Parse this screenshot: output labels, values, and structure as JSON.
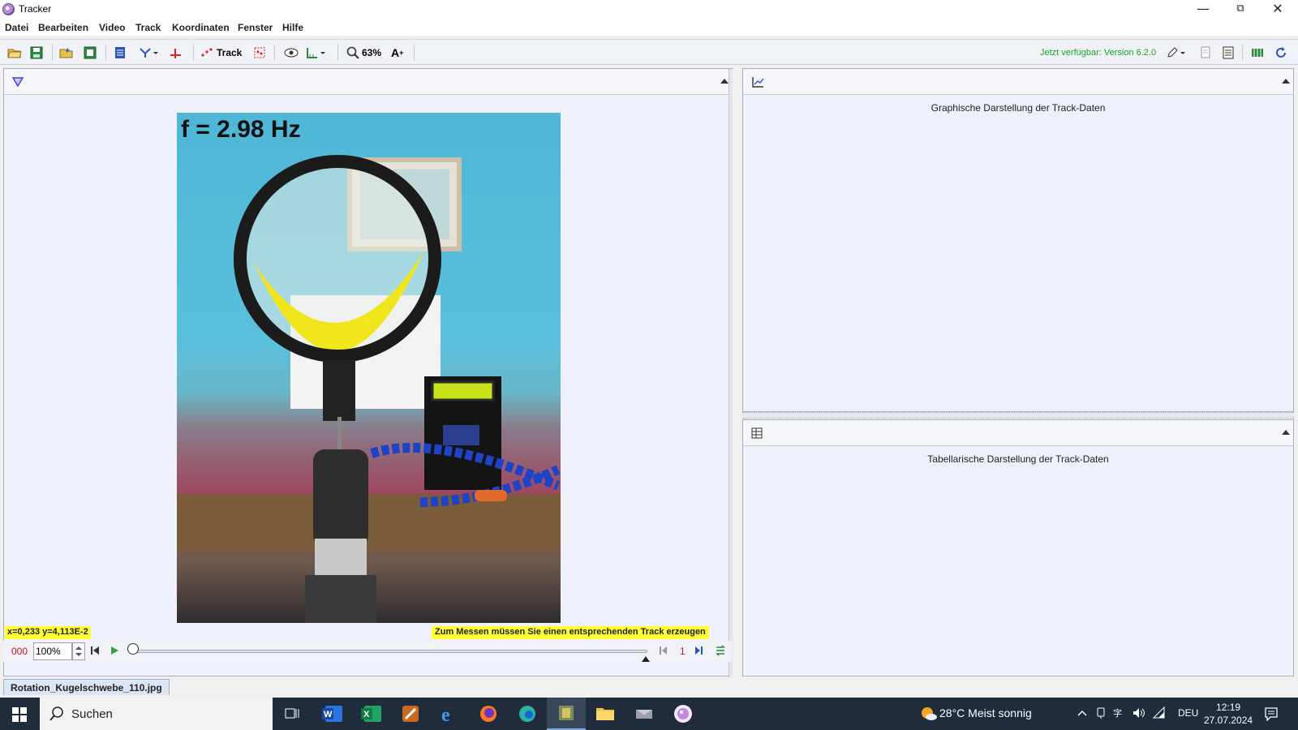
{
  "window": {
    "title": "Tracker",
    "controls": [
      "minimize",
      "restore",
      "close"
    ]
  },
  "menubar": {
    "items": [
      "Datei",
      "Bearbeiten",
      "Video",
      "Track",
      "Koordinaten",
      "Fenster",
      "Hilfe"
    ]
  },
  "toolbar": {
    "track_label": "Track",
    "zoom_label": "63%",
    "update_notice": "Jetzt verfügbar: Version 6.2.0"
  },
  "video_panel": {
    "overlay_text": "f = 2.98 Hz",
    "coord_readout": "x=0,233  y=4,113E-2",
    "hint": "Zum Messen müssen Sie einen entsprechenden Track erzeugen"
  },
  "player": {
    "frame_counter": "000",
    "rate": "100%",
    "step_size": "1"
  },
  "plot_panel": {
    "caption": "Graphische Darstellung der Track-Daten"
  },
  "table_panel": {
    "caption": "Tabellarische Darstellung der Track-Daten"
  },
  "file_tab": {
    "name": "Rotation_Kugelschwebe_110.jpg"
  },
  "taskbar": {
    "search_label": "Suchen",
    "weather": "28°C  Meist sonnig",
    "language": "DEU",
    "time": "12:19",
    "date": "27.07.2024"
  },
  "colors": {
    "hint_background": "#ffff33",
    "update_text": "#1aa32a",
    "frame_counter": "#c8161d",
    "panel_background": "#eef0fb",
    "taskbar": "#202b3c"
  }
}
